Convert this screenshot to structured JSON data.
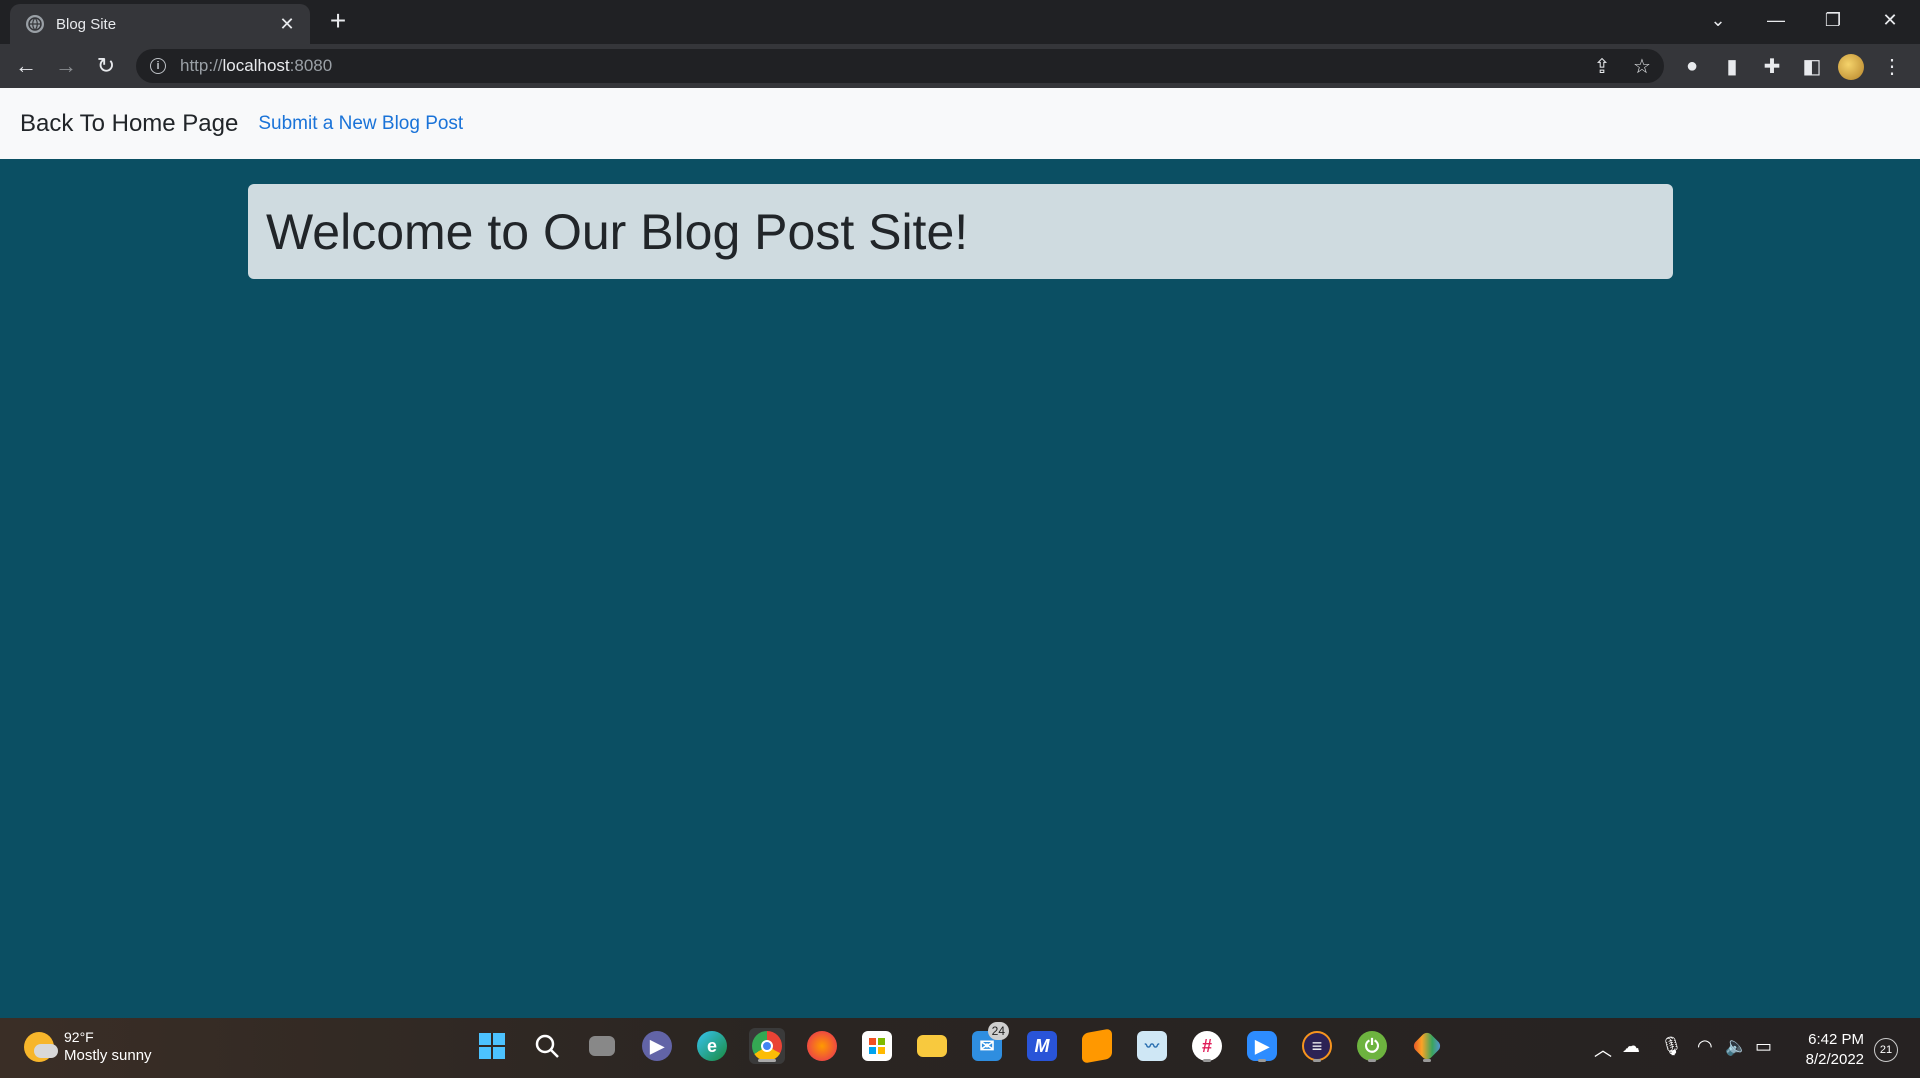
{
  "browser": {
    "tab_title": "Blog Site",
    "close_tab_glyph": "✕",
    "new_tab_glyph": "+",
    "url_scheme": "http://",
    "url_host": "localhost",
    "url_port": ":8080"
  },
  "navbar": {
    "brand": "Back To Home Page",
    "submit_link": "Submit a New Blog Post"
  },
  "main": {
    "heading": "Welcome to Our Blog Post Site!"
  },
  "taskbar": {
    "weather_temp": "92°F",
    "weather_condition": "Mostly sunny",
    "mail_badge": "24",
    "clock_time": "6:42 PM",
    "clock_date": "8/2/2022",
    "notification_count": "21"
  },
  "colors": {
    "page_background": "#0b4f63",
    "navbar_background": "#f8f9fa",
    "link": "#1a73d8",
    "jumbotron": "#cfdbe0"
  }
}
